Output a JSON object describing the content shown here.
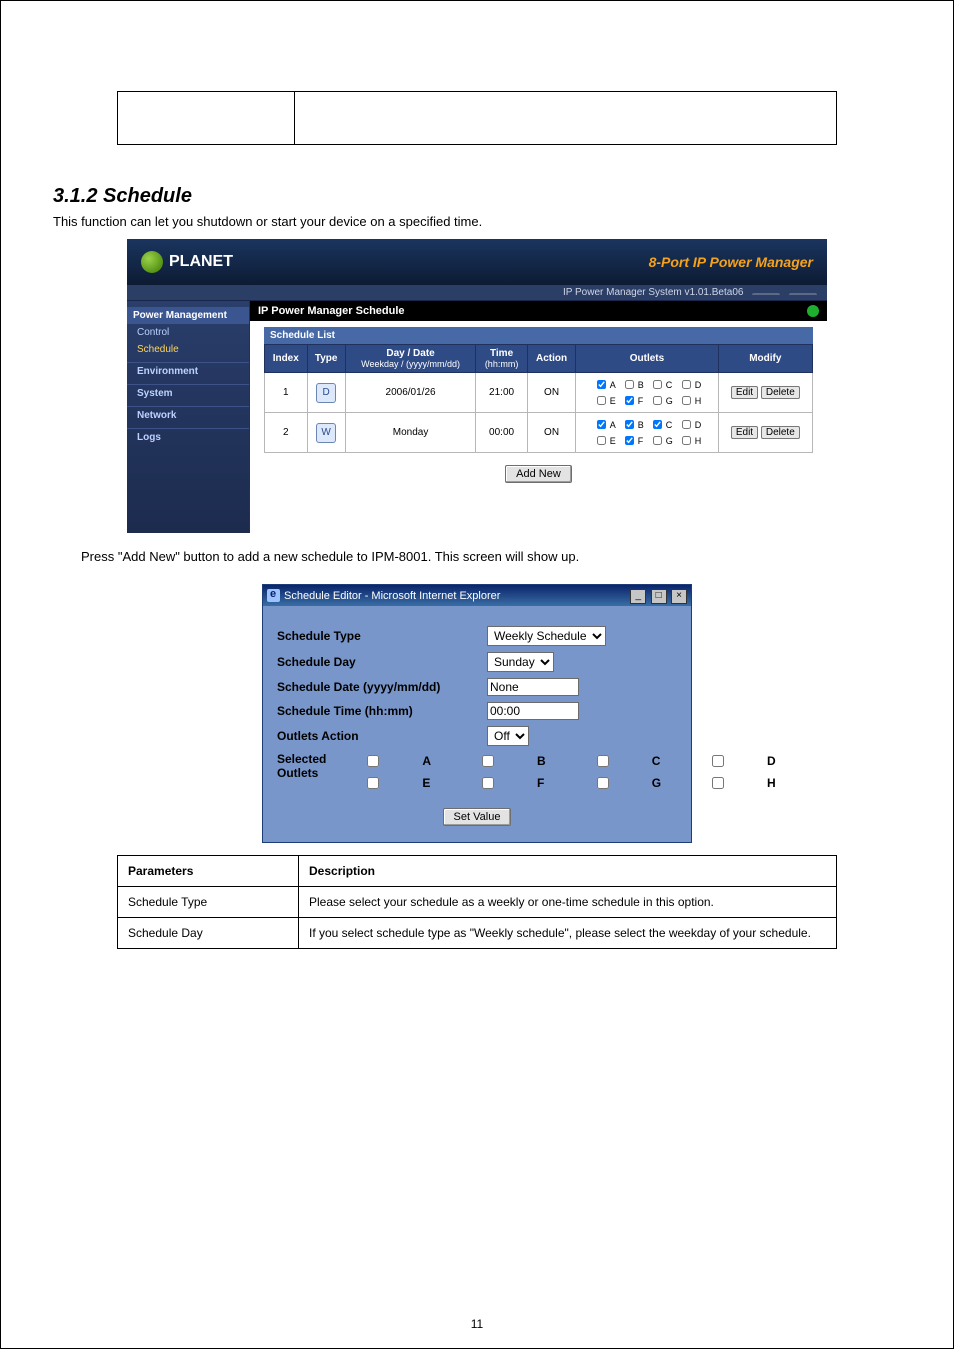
{
  "plain_table": {
    "left": "",
    "right": ""
  },
  "section": {
    "title": "3.1.2 Schedule",
    "sub": "This function can let you shutdown or start your device on a specified time."
  },
  "app": {
    "brand": "PLANET",
    "product_title": "8-Port IP Power Manager",
    "version_bar": "IP Power Manager System v1.01.Beta06",
    "tabs": {
      "a": " ",
      "b": " "
    }
  },
  "sidebar": {
    "top": "Power Management",
    "items": [
      "Control",
      "Schedule",
      "Environment",
      "System",
      "Network",
      "Logs"
    ],
    "active_index": 1
  },
  "main": {
    "heading": "IP Power Manager Schedule",
    "panel_title": "Schedule List",
    "headers": {
      "index": "Index",
      "type": "Type",
      "daydate": "Day / Date",
      "daydate_sub": "Weekday / (yyyy/mm/dd)",
      "time": "Time",
      "time_sub": "(hh:mm)",
      "action": "Action",
      "outlets": "Outlets",
      "modify": "Modify"
    },
    "rows": [
      {
        "index": "1",
        "type_label": "D",
        "daydate": "2006/01/26",
        "time": "21:00",
        "action": "ON",
        "outlets": {
          "A": true,
          "B": false,
          "C": false,
          "D": false,
          "E": false,
          "F": true,
          "G": false,
          "H": false
        },
        "edit": "Edit",
        "delete": "Delete"
      },
      {
        "index": "2",
        "type_label": "W",
        "daydate": "Monday",
        "time": "00:00",
        "action": "ON",
        "outlets": {
          "A": true,
          "B": true,
          "C": true,
          "D": false,
          "E": false,
          "F": true,
          "G": false,
          "H": false
        },
        "edit": "Edit",
        "delete": "Delete"
      }
    ],
    "add_new": "Add New"
  },
  "addnew_text": "Press \"Add New\" button to add a new schedule to IPM-8001. This screen will show up.",
  "popup": {
    "title": "Schedule Editor - Microsoft Internet Explorer",
    "fields": {
      "type_label": "Schedule Type",
      "type_value": "Weekly Schedule",
      "day_label": "Schedule Day",
      "day_value": "Sunday",
      "date_label": "Schedule Date (yyyy/mm/dd)",
      "date_value": "None",
      "time_label": "Schedule Time (hh:mm)",
      "time_value": "00:00",
      "action_label": "Outlets Action",
      "action_value": "Off",
      "selected_label": "Selected Outlets"
    },
    "outlet_labels": [
      "A",
      "B",
      "C",
      "D",
      "E",
      "F",
      "G",
      "H"
    ],
    "set_value": "Set Value"
  },
  "params_table": {
    "h1": "Parameters",
    "h2": "Description",
    "rows": [
      {
        "p": "Schedule Type",
        "d": "Please select your schedule as a weekly or one-time schedule in this option."
      },
      {
        "p": "Schedule Day",
        "d": "If you select schedule type as \"Weekly schedule\", please select the weekday of your schedule."
      }
    ]
  },
  "page_number": "11"
}
